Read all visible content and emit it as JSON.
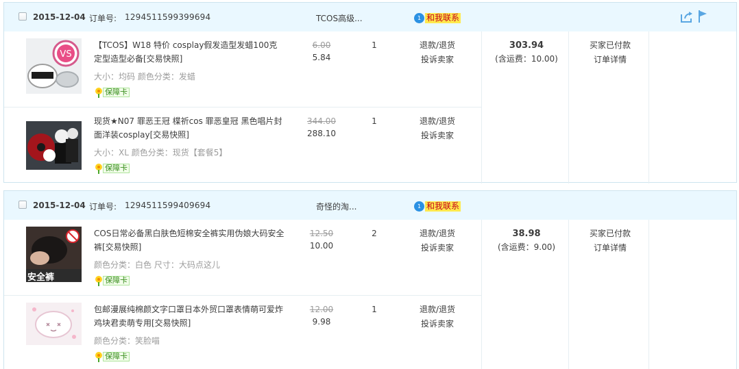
{
  "orders": [
    {
      "date": "2015-12-04",
      "order_no_label": "订单号:",
      "order_no": "1294511599399694",
      "seller": "TCOS高级...",
      "contact_label": "和我联系",
      "contact_dot": "1",
      "total": "303.94",
      "shipping": "(含运费：10.00)",
      "status": "买家已付款",
      "detail": "订单详情",
      "items": [
        {
          "title": "【TCOS】W18 特价 cosplay假发造型发蜡100克 定型造型必备[交易快照]",
          "attrs": "大小：均码  颜色分类：发蜡",
          "badge": "保障卡",
          "price_orig": "6.00",
          "price_now": "5.84",
          "qty": "1",
          "refund": "退款/退货",
          "complain": "投诉卖家"
        },
        {
          "title": "现货★N07 罪恶王冠 楪祈cos 罪恶皇冠 黑色唱片封面洋装cosplay[交易快照]",
          "attrs": "大小：XL  颜色分类：现货【套餐5】",
          "badge": "保障卡",
          "price_orig": "344.00",
          "price_now": "288.10",
          "qty": "1",
          "refund": "退款/退货",
          "complain": "投诉卖家"
        }
      ]
    },
    {
      "date": "2015-12-04",
      "order_no_label": "订单号:",
      "order_no": "1294511599409694",
      "seller": "奇怪的淘...",
      "contact_label": "和我联系",
      "contact_dot": "1",
      "total": "38.98",
      "shipping": "(含运费：9.00)",
      "status": "买家已付款",
      "detail": "订单详情",
      "items": [
        {
          "title": "COS日常必备黑白肤色短棉安全裤实用伪娘大码安全裤[交易快照]",
          "attrs": "颜色分类：白色  尺寸：大码点这儿",
          "badge": "保障卡",
          "thumb_text": "安全裤",
          "price_orig": "12.50",
          "price_now": "10.00",
          "qty": "2",
          "refund": "退款/退货",
          "complain": "投诉卖家"
        },
        {
          "title": "包邮漫展纯棉颜文字口罩日本外贸口罩表情萌可爱炸鸡块君卖萌专用[交易快照]",
          "attrs": "颜色分类：笑脸喵",
          "badge": "保障卡",
          "price_orig": "12.00",
          "price_now": "9.98",
          "qty": "1",
          "refund": "退款/退货",
          "complain": "投诉卖家"
        }
      ]
    }
  ],
  "colors": {
    "header_bg": "#eaf8ff",
    "border": "#cde4ee",
    "contact_bg": "#ffe94d",
    "contact_text": "#c4001a",
    "icon_blue": "#2b91e3",
    "badge_green": "#3a8e1f"
  },
  "icons": {
    "share": "share-icon",
    "flag": "flag-icon",
    "contact": "chat-bubble-icon",
    "badge": "flower-icon"
  }
}
